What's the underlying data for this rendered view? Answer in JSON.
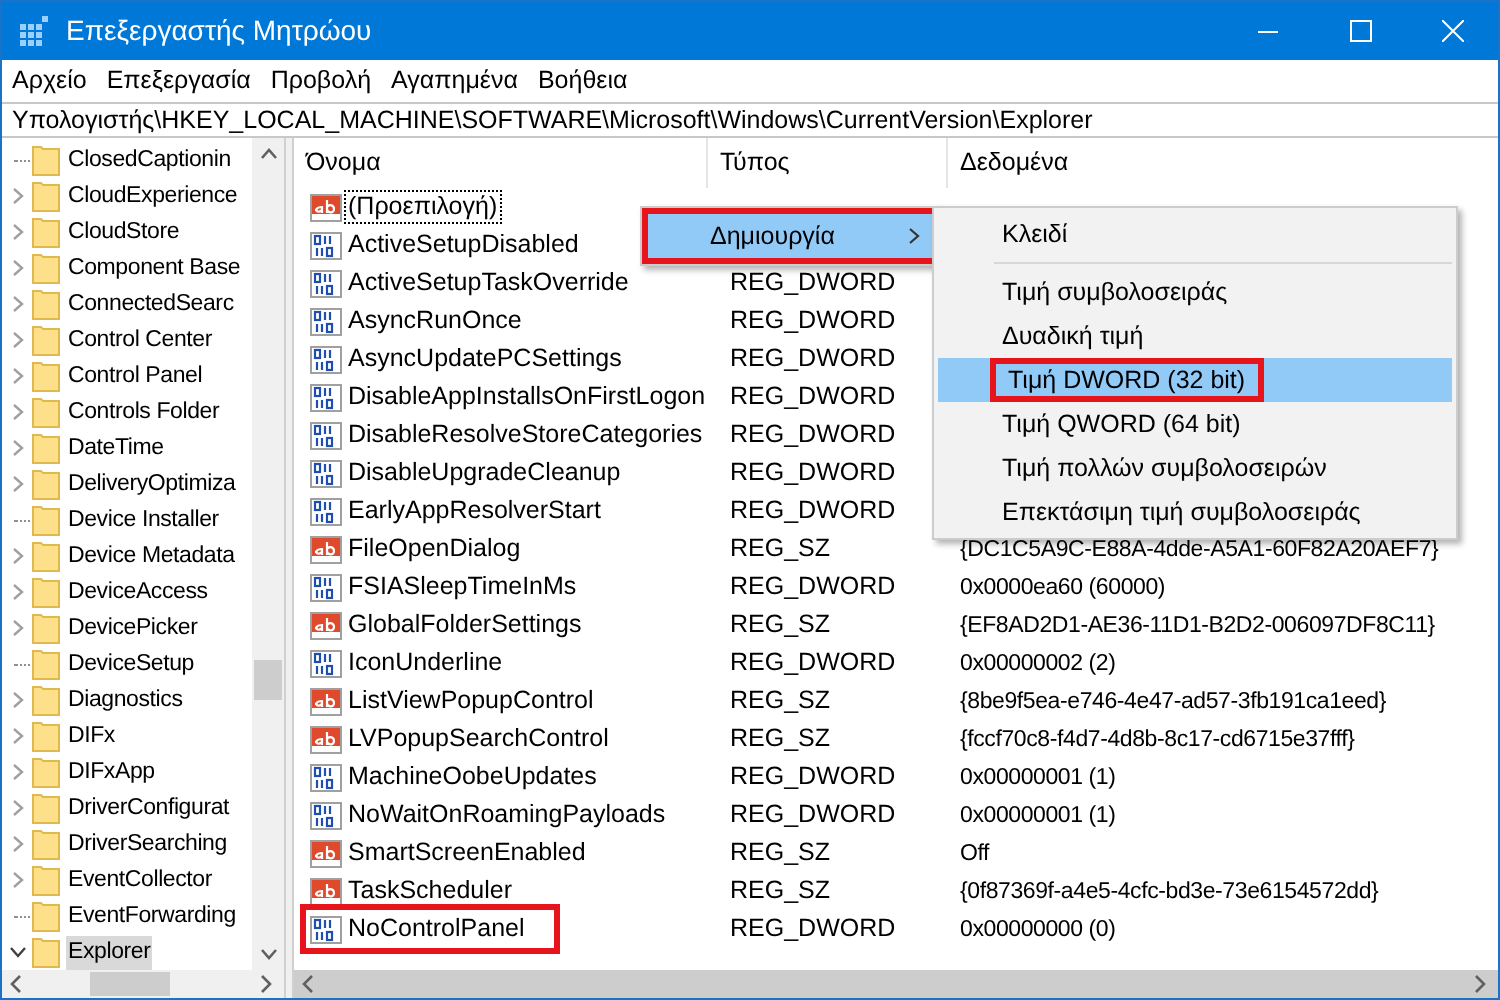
{
  "window": {
    "title": "Επεξεργαστής Μητρώου"
  },
  "menu_bar": [
    "Αρχείο",
    "Επεξεργασία",
    "Προβολή",
    "Αγαπημένα",
    "Βοήθεια"
  ],
  "address": "Υπολογιστής\\HKEY_LOCAL_MACHINE\\SOFTWARE\\Microsoft\\Windows\\CurrentVersion\\Explorer",
  "tree": [
    {
      "label": "ClosedCaptionin",
      "expandable": false,
      "selected": false
    },
    {
      "label": "CloudExperience",
      "expandable": true,
      "selected": false
    },
    {
      "label": "CloudStore",
      "expandable": true,
      "selected": false
    },
    {
      "label": "Component Base",
      "expandable": true,
      "selected": false
    },
    {
      "label": "ConnectedSearc",
      "expandable": true,
      "selected": false
    },
    {
      "label": "Control Center",
      "expandable": true,
      "selected": false
    },
    {
      "label": "Control Panel",
      "expandable": true,
      "selected": false
    },
    {
      "label": "Controls Folder",
      "expandable": true,
      "selected": false
    },
    {
      "label": "DateTime",
      "expandable": true,
      "selected": false
    },
    {
      "label": "DeliveryOptimiza",
      "expandable": true,
      "selected": false
    },
    {
      "label": "Device Installer",
      "expandable": false,
      "selected": false
    },
    {
      "label": "Device Metadata",
      "expandable": true,
      "selected": false
    },
    {
      "label": "DeviceAccess",
      "expandable": true,
      "selected": false
    },
    {
      "label": "DevicePicker",
      "expandable": true,
      "selected": false
    },
    {
      "label": "DeviceSetup",
      "expandable": false,
      "selected": false
    },
    {
      "label": "Diagnostics",
      "expandable": true,
      "selected": false
    },
    {
      "label": "DIFx",
      "expandable": true,
      "selected": false
    },
    {
      "label": "DIFxApp",
      "expandable": true,
      "selected": false
    },
    {
      "label": "DriverConfigurat",
      "expandable": true,
      "selected": false
    },
    {
      "label": "DriverSearching",
      "expandable": true,
      "selected": false
    },
    {
      "label": "EventCollector",
      "expandable": true,
      "selected": false
    },
    {
      "label": "EventForwarding",
      "expandable": false,
      "selected": false
    },
    {
      "label": "Explorer",
      "expandable": true,
      "expanded": true,
      "selected": true
    }
  ],
  "table": {
    "columns": [
      "Όνομα",
      "Τύπος",
      "Δεδομένα"
    ],
    "rows": [
      {
        "kind": "string",
        "name": "(Προεπιλογή)",
        "selected": true,
        "marked": false
      },
      {
        "kind": "dword",
        "name": "ActiveSetupDisabled",
        "selected": false,
        "marked": false
      },
      {
        "kind": "dword",
        "name": "ActiveSetupTaskOverride",
        "type": "REG_DWORD",
        "selected": false,
        "marked": false
      },
      {
        "kind": "dword",
        "name": "AsyncRunOnce",
        "type": "REG_DWORD",
        "selected": false,
        "marked": false
      },
      {
        "kind": "dword",
        "name": "AsyncUpdatePCSettings",
        "type": "REG_DWORD",
        "selected": false,
        "marked": false
      },
      {
        "kind": "dword",
        "name": "DisableAppInstallsOnFirstLogon",
        "type": "REG_DWORD",
        "selected": false,
        "marked": false
      },
      {
        "kind": "dword",
        "name": "DisableResolveStoreCategories",
        "type": "REG_DWORD",
        "selected": false,
        "marked": false
      },
      {
        "kind": "dword",
        "name": "DisableUpgradeCleanup",
        "type": "REG_DWORD",
        "selected": false,
        "marked": false
      },
      {
        "kind": "dword",
        "name": "EarlyAppResolverStart",
        "type": "REG_DWORD",
        "selected": false,
        "marked": false
      },
      {
        "kind": "string",
        "name": "FileOpenDialog",
        "type": "REG_SZ",
        "data": "{DC1C5A9C-E88A-4dde-A5A1-60F82A20AEF7}",
        "selected": false,
        "marked": false
      },
      {
        "kind": "dword",
        "name": "FSIASleepTimeInMs",
        "type": "REG_DWORD",
        "data": "0x0000ea60 (60000)",
        "selected": false,
        "marked": false
      },
      {
        "kind": "string",
        "name": "GlobalFolderSettings",
        "type": "REG_SZ",
        "data": "{EF8AD2D1-AE36-11D1-B2D2-006097DF8C11}",
        "selected": false,
        "marked": false
      },
      {
        "kind": "dword",
        "name": "IconUnderline",
        "type": "REG_DWORD",
        "data": "0x00000002 (2)",
        "selected": false,
        "marked": false
      },
      {
        "kind": "string",
        "name": "ListViewPopupControl",
        "type": "REG_SZ",
        "data": "{8be9f5ea-e746-4e47-ad57-3fb191ca1eed}",
        "selected": false,
        "marked": false
      },
      {
        "kind": "string",
        "name": "LVPopupSearchControl",
        "type": "REG_SZ",
        "data": "{fccf70c8-f4d7-4d8b-8c17-cd6715e37fff}",
        "selected": false,
        "marked": false
      },
      {
        "kind": "dword",
        "name": "MachineOobeUpdates",
        "type": "REG_DWORD",
        "data": "0x00000001 (1)",
        "selected": false,
        "marked": false
      },
      {
        "kind": "dword",
        "name": "NoWaitOnRoamingPayloads",
        "type": "REG_DWORD",
        "data": "0x00000001 (1)",
        "selected": false,
        "marked": false
      },
      {
        "kind": "string",
        "name": "SmartScreenEnabled",
        "type": "REG_SZ",
        "data": "Off",
        "selected": false,
        "marked": false
      },
      {
        "kind": "string",
        "name": "TaskScheduler",
        "type": "REG_SZ",
        "data": "{0f87369f-a4e5-4cfc-bd3e-73e6154572dd}",
        "selected": false,
        "marked": false
      },
      {
        "kind": "dword",
        "name": "NoControlPanel",
        "type": "REG_DWORD",
        "data": "0x00000000 (0)",
        "selected": false,
        "marked": true
      }
    ]
  },
  "context_menu": {
    "items": [
      {
        "label": "Δημιουργία",
        "has_submenu": true,
        "selected": true,
        "marked": true
      }
    ]
  },
  "submenu": {
    "items": [
      {
        "kind": "item",
        "label": "Κλειδί",
        "selected": false,
        "marked": false
      },
      {
        "kind": "separator"
      },
      {
        "kind": "item",
        "label": "Τιμή συμβολοσειράς",
        "selected": false,
        "marked": false
      },
      {
        "kind": "item",
        "label": "Δυαδική τιμή",
        "selected": false,
        "marked": false
      },
      {
        "kind": "item",
        "label": "Τιμή DWORD (32 bit)",
        "selected": true,
        "marked": true
      },
      {
        "kind": "item",
        "label": "Τιμή QWORD (64 bit)",
        "selected": false,
        "marked": false
      },
      {
        "kind": "item",
        "label": "Τιμή πολλών συμβολοσειρών",
        "selected": false,
        "marked": false
      },
      {
        "kind": "item",
        "label": "Επεκτάσιμη τιμή συμβολοσειράς",
        "selected": false,
        "marked": false
      }
    ]
  }
}
